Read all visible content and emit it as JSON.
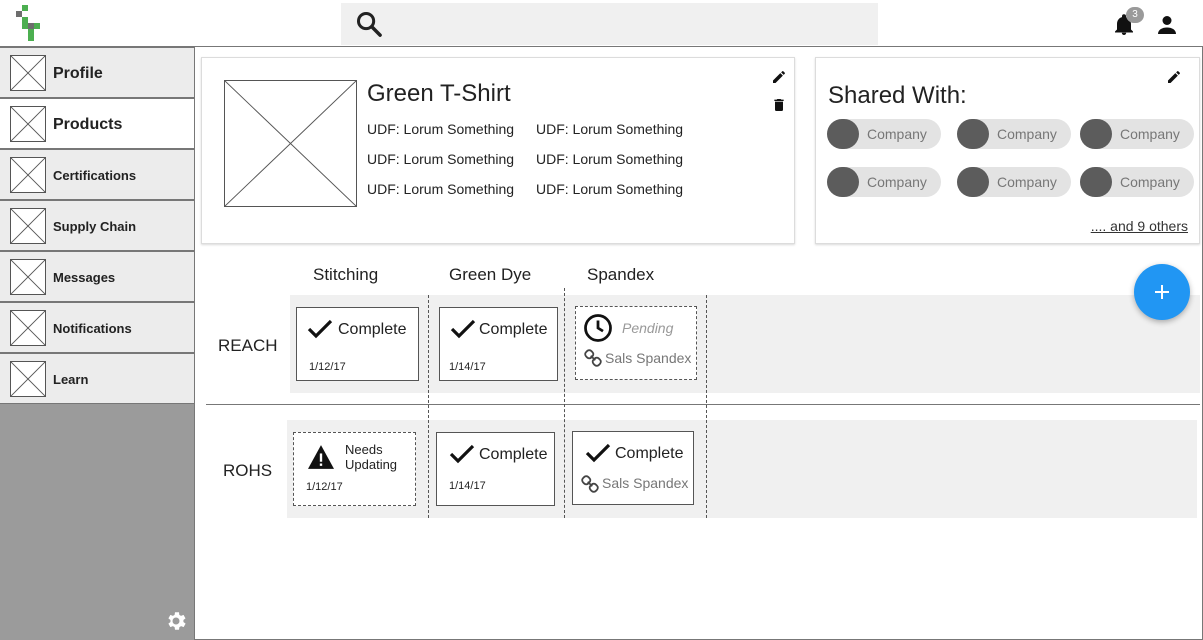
{
  "header": {
    "notification_count": "3",
    "search_placeholder": ""
  },
  "sidebar": {
    "items": [
      {
        "label": "Profile"
      },
      {
        "label": "Products"
      },
      {
        "label": "Certifications"
      },
      {
        "label": "Supply Chain"
      },
      {
        "label": "Messages"
      },
      {
        "label": "Notifications"
      },
      {
        "label": "Learn"
      }
    ],
    "active": "Products"
  },
  "product": {
    "title": "Green T-Shirt",
    "udfs": [
      "UDF: Lorum Something",
      "UDF: Lorum Something",
      "UDF: Lorum Something",
      "UDF: Lorum Something",
      "UDF: Lorum Something",
      "UDF: Lorum Something"
    ]
  },
  "shared": {
    "title": "Shared With:",
    "companies": [
      "Company",
      "Company",
      "Company",
      "Company",
      "Company",
      "Company"
    ],
    "others_link": ".... and 9 others"
  },
  "grid": {
    "columns": [
      "Stitching",
      "Green Dye",
      "Spandex"
    ],
    "rows": [
      {
        "label": "REACH",
        "cells": [
          {
            "status": "Complete",
            "date": "1/12/17"
          },
          {
            "status": "Complete",
            "date": "1/14/17"
          },
          {
            "status": "Pending",
            "supplier": "Sals Spandex"
          }
        ]
      },
      {
        "label": "ROHS",
        "cells": [
          {
            "status": "Needs Updating",
            "status_line1": "Needs",
            "status_line2": "Updating",
            "date": "1/12/17"
          },
          {
            "status": "Complete",
            "date": "1/14/17"
          },
          {
            "status": "Complete",
            "supplier": "Sals Spandex"
          }
        ]
      }
    ]
  },
  "colors": {
    "accent": "#2196f3",
    "sidebar_bg": "#9b9b9b",
    "logo_green": "#4caf50",
    "logo_gray": "#6d6d6d"
  },
  "icons": {
    "logo": "logo-icon",
    "search": "search-icon",
    "bell": "bell-icon",
    "person": "person-icon",
    "gear": "gear-icon",
    "edit": "pencil-icon",
    "delete": "trash-icon",
    "complete": "check-icon",
    "pending": "clock-icon",
    "warning": "warning-icon",
    "link": "link-icon",
    "add": "plus-icon"
  }
}
